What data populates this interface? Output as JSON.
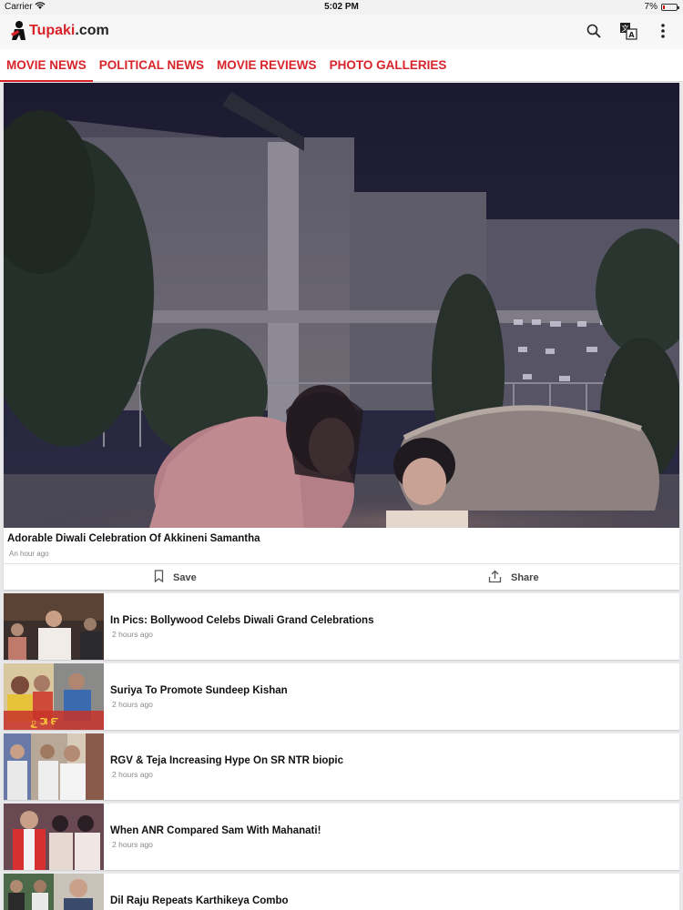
{
  "status_bar": {
    "carrier": "Carrier",
    "time": "5:02 PM",
    "battery": "7%"
  },
  "app": {
    "logo_prefix": "",
    "logo_name": "Tupaki",
    "logo_suffix": ".com",
    "brand_color": "#d8232a",
    "actions": [
      "search-icon",
      "translate-icon",
      "more-vertical-icon"
    ]
  },
  "tabs": [
    {
      "label": "MOVIE NEWS",
      "active": true
    },
    {
      "label": "POLITICAL NEWS",
      "active": false
    },
    {
      "label": "MOVIE REVIEWS",
      "active": false
    },
    {
      "label": "PHOTO GALLERIES",
      "active": false
    }
  ],
  "featured": {
    "title": "Adorable Diwali Celebration Of Akkineni Samantha",
    "time": "An hour ago",
    "save_label": "Save",
    "share_label": "Share"
  },
  "news": [
    {
      "title": "In Pics: Bollywood Celebs Diwali Grand Celebrations",
      "time": "2 hours ago"
    },
    {
      "title": "Suriya To Promote Sundeep Kishan",
      "time": "2 hours ago"
    },
    {
      "title": "RGV & Teja Increasing Hype On SR NTR biopic",
      "time": "2 hours ago"
    },
    {
      "title": "When ANR Compared Sam With Mahanati!",
      "time": "2 hours ago"
    },
    {
      "title": "Dil Raju Repeats Karthikeya Combo",
      "time": ""
    }
  ]
}
